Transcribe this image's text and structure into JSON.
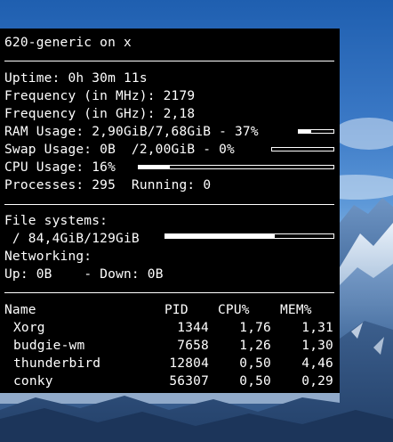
{
  "conky": {
    "header": "620-generic on x",
    "uptime": {
      "label": "Uptime:",
      "value": "0h 30m 11s"
    },
    "freq_mhz": {
      "label": "Frequency (in MHz):",
      "value": "2179"
    },
    "freq_ghz": {
      "label": "Frequency (in GHz):",
      "value": "2,18"
    },
    "ram": {
      "label": "RAM Usage:",
      "value": "2,90GiB/7,68GiB - 37%",
      "percent": 37
    },
    "swap": {
      "label": "Swap Usage:",
      "value": "0B  /2,00GiB - 0%",
      "percent": 0
    },
    "cpu": {
      "label": "CPU Usage:",
      "value": "16%",
      "percent": 16
    },
    "processes": {
      "label": "Processes:",
      "value": "295",
      "running_label": "Running:",
      "running_value": "0"
    },
    "filesystems": {
      "label": "File systems:",
      "value": " / 84,4GiB/129GiB",
      "percent": 65
    },
    "networking": {
      "label": "Networking:",
      "up_label": "Up:",
      "up_value": "0B",
      "down_label": "- Down:",
      "down_value": "0B"
    },
    "table": {
      "headers": {
        "name": "Name",
        "pid": "PID",
        "cpu": "CPU%",
        "mem": "MEM%"
      },
      "rows": [
        {
          "name": "Xorg",
          "pid": "1344",
          "cpu": "1,76",
          "mem": "1,31"
        },
        {
          "name": "budgie-wm",
          "pid": "7658",
          "cpu": "1,26",
          "mem": "1,30"
        },
        {
          "name": "thunderbird",
          "pid": "12804",
          "cpu": "0,50",
          "mem": "4,46"
        },
        {
          "name": "conky",
          "pid": "56307",
          "cpu": "0,50",
          "mem": "0,29"
        }
      ]
    }
  }
}
